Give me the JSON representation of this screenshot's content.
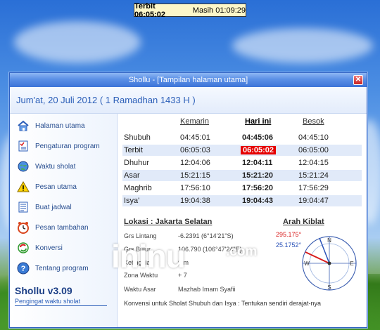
{
  "taskbar": {
    "label1": "Terbit 06:05:02",
    "label2": "Masih 01:09:29"
  },
  "window": {
    "title": "Shollu - [Tampilan halaman utama]",
    "date": "Jum'at, 20 Juli 2012 ( 1 Ramadhan 1433 H )"
  },
  "sidebar": {
    "items": [
      {
        "label": "Halaman utama",
        "icon": "home-icon"
      },
      {
        "label": "Pengaturan program",
        "icon": "checklist-icon"
      },
      {
        "label": "Waktu sholat",
        "icon": "globe-icon"
      },
      {
        "label": "Pesan utama",
        "icon": "warning-icon"
      },
      {
        "label": "Buat jadwal",
        "icon": "document-icon"
      },
      {
        "label": "Pesan tambahan",
        "icon": "clock-icon"
      },
      {
        "label": "Konversi",
        "icon": "convert-icon"
      },
      {
        "label": "Tentang program",
        "icon": "help-icon"
      }
    ],
    "brand_title": "Shollu v3.09",
    "brand_subtitle": "Pengingat waktu sholat"
  },
  "prayer_table": {
    "headers": [
      "Kemarin",
      "Hari ini",
      "Besok"
    ],
    "rows": [
      {
        "name": "Shubuh",
        "kemarin": "04:45:01",
        "hari_ini": "04:45:06",
        "besok": "04:45:10"
      },
      {
        "name": "Terbit",
        "kemarin": "06:05:03",
        "hari_ini": "06:05:02",
        "besok": "06:05:00"
      },
      {
        "name": "Dhuhur",
        "kemarin": "12:04:06",
        "hari_ini": "12:04:11",
        "besok": "12:04:15"
      },
      {
        "name": "Asar",
        "kemarin": "15:21:15",
        "hari_ini": "15:21:20",
        "besok": "15:21:24"
      },
      {
        "name": "Maghrib",
        "kemarin": "17:56:10",
        "hari_ini": "17:56:20",
        "besok": "17:56:29"
      },
      {
        "name": "Isya'",
        "kemarin": "19:04:38",
        "hari_ini": "19:04:43",
        "besok": "19:04:47"
      }
    ]
  },
  "lokasi": {
    "title": "Lokasi :  Jakarta Selatan",
    "rows": [
      {
        "label": "Grs Lintang",
        "value": "-6.2391 (6°14'21\"S)"
      },
      {
        "label": "Grs Bujur",
        "value": "106.790 (106°47'24\"E)"
      },
      {
        "label": "Ketinggian",
        "value": "0 m"
      },
      {
        "label": "Zona Waktu",
        "value": "+ 7"
      },
      {
        "label": "Waktu Asar",
        "value": "Mazhab Imam Syafii"
      }
    ],
    "note": "Konvensi untuk Sholat Shubuh dan Isya : Tentukan sendiri derajat-nya"
  },
  "kiblat": {
    "title": "Arah Kiblat",
    "value1": "295.175°",
    "value2": "25.1752°",
    "directions": {
      "n": "N",
      "s": "S",
      "e": "E",
      "w": "W"
    }
  },
  "watermark": {
    "text": "ininu",
    "suffix": ".com"
  },
  "colors": {
    "accent": "#2b5eb8",
    "highlight": "#e50000",
    "row_alt": "#e1eaf9"
  }
}
